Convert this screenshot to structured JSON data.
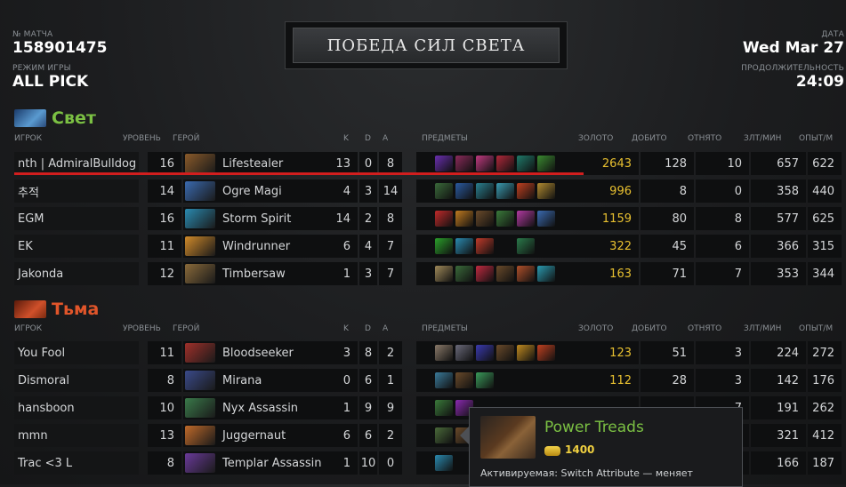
{
  "match": {
    "id_label": "№ МАТЧА",
    "id": "158901475",
    "mode_label": "РЕЖИМ ИГРЫ",
    "mode": "ALL PICK"
  },
  "result": {
    "banner": "ПОБЕДА СИЛ СВЕТА"
  },
  "date": {
    "label": "ДАТА",
    "value": "Wed Mar 27",
    "duration_label": "ПРОДОЛЖИТЕЛЬНОСТЬ",
    "duration": "24:09"
  },
  "columns": {
    "player": "ИГРОК",
    "level": "УРОВЕНЬ",
    "hero": "ГЕРОЙ",
    "k": "K",
    "d": "D",
    "a": "A",
    "items": "ПРЕДМЕТЫ",
    "gold": "ЗОЛОТО",
    "lh": "ДОБИТО",
    "dn": "ОТНЯТО",
    "gpm": "ЗЛТ/МИН",
    "xpm": "ОПЫТ/М"
  },
  "colors": {
    "radiant": "#7bc043",
    "dire": "#e0552a",
    "gold": "#e8c030",
    "highlight": "#d21e1e"
  },
  "radiant": {
    "name": "Свет",
    "players": [
      {
        "player": "nth | AdmiralBulldog",
        "level": "16",
        "hero": "Lifestealer",
        "k": "13",
        "d": "0",
        "a": "8",
        "gold": "2643",
        "lh": "128",
        "dn": "10",
        "gpm": "657",
        "xpm": "622",
        "items": [
          "#6a2fb0",
          "#8a2a5a",
          "#c03a80",
          "#b0283a",
          "#1f7a6a",
          "#3a8a30"
        ]
      },
      {
        "player": "추적",
        "level": "14",
        "hero": "Ogre Magi",
        "k": "4",
        "d": "3",
        "a": "14",
        "gold": "996",
        "lh": "8",
        "dn": "0",
        "gpm": "358",
        "xpm": "440",
        "items": [
          "#3a6a3a",
          "#2a5aa0",
          "#2a8090",
          "#3a9ab0",
          "#c04020",
          "#b08a30"
        ]
      },
      {
        "player": "EGM",
        "level": "16",
        "hero": "Storm Spirit",
        "k": "14",
        "d": "2",
        "a": "8",
        "gold": "1159",
        "lh": "80",
        "dn": "8",
        "gpm": "577",
        "xpm": "625",
        "items": [
          "#c02a2a",
          "#c07a20",
          "#6a4a2a",
          "#3a7a3a",
          "#b03aa0",
          "#3a6ab0"
        ]
      },
      {
        "player": "EK",
        "level": "11",
        "hero": "Windrunner",
        "k": "6",
        "d": "4",
        "a": "7",
        "gold": "322",
        "lh": "45",
        "dn": "6",
        "gpm": "366",
        "xpm": "315",
        "items": [
          "#2aa02a",
          "#2a8ab0",
          "#c03a2a",
          "#1c1c1c",
          "#2a7a4a",
          "#1c1c1c"
        ]
      },
      {
        "player": "Jakonda",
        "level": "12",
        "hero": "Timbersaw",
        "k": "1",
        "d": "3",
        "a": "7",
        "gold": "163",
        "lh": "71",
        "dn": "7",
        "gpm": "353",
        "xpm": "344",
        "items": [
          "#a08a5a",
          "#3a6a3a",
          "#c02a40",
          "#6a4a2a",
          "#b0502a",
          "#2a9ab0"
        ]
      }
    ]
  },
  "dire": {
    "name": "Тьма",
    "players": [
      {
        "player": "You Fool",
        "level": "11",
        "hero": "Bloodseeker",
        "k": "3",
        "d": "8",
        "a": "2",
        "gold": "123",
        "lh": "51",
        "dn": "3",
        "gpm": "224",
        "xpm": "272",
        "items": [
          "#8a7a6a",
          "#6a6a7a",
          "#3a3ab0",
          "#6a4a2a",
          "#c08a20",
          "#c04020"
        ]
      },
      {
        "player": "Dismoral",
        "level": "8",
        "hero": "Mirana",
        "k": "0",
        "d": "6",
        "a": "1",
        "gold": "112",
        "lh": "28",
        "dn": "3",
        "gpm": "142",
        "xpm": "176",
        "items": [
          "#3a7a9a",
          "#6a4a2a",
          "#3a9a5a",
          "#1c1c1c",
          "#1c1c1c",
          "#1c1c1c"
        ]
      },
      {
        "player": "hansboon",
        "level": "10",
        "hero": "Nyx Assassin",
        "k": "1",
        "d": "9",
        "a": "9",
        "gold": "",
        "lh": "",
        "dn": "7",
        "gpm": "191",
        "xpm": "262",
        "items": [
          "#3a7a3a",
          "#8a2ab0",
          "#1c1c1c",
          "#1c1c1c",
          "#1c1c1c",
          "#1c1c1c"
        ]
      },
      {
        "player": "mmn",
        "level": "13",
        "hero": "Juggernaut",
        "k": "6",
        "d": "6",
        "a": "2",
        "gold": "",
        "lh": "",
        "dn": "",
        "gpm": "321",
        "xpm": "412",
        "items": [
          "#4a6a3a",
          "#6a4a2a",
          "#1c1c1c",
          "#1c1c1c",
          "#1c1c1c",
          "#1c1c1c"
        ]
      },
      {
        "player": "Trac <3 L",
        "level": "8",
        "hero": "Templar Assassin",
        "k": "1",
        "d": "10",
        "a": "0",
        "gold": "",
        "lh": "",
        "dn": "",
        "gpm": "166",
        "xpm": "187",
        "items": [
          "#2a8ab0",
          "#1c1c1c",
          "#1c1c1c",
          "#1c1c1c",
          "#1c1c1c",
          "#1c1c1c"
        ]
      }
    ]
  },
  "tooltip": {
    "name": "Power Treads",
    "cost": "1400",
    "desc": "Активируемая: Switch Attribute — меняет",
    "icon": "boots-icon"
  }
}
